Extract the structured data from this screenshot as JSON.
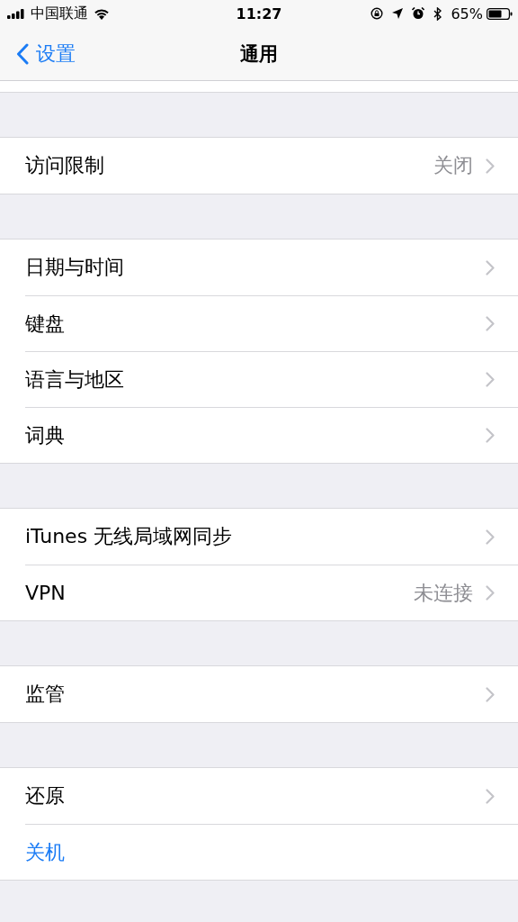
{
  "status_bar": {
    "carrier": "中国联通",
    "time": "11:27",
    "battery": "65%"
  },
  "nav": {
    "back": "设置",
    "title": "通用"
  },
  "groups": [
    {
      "rows": [
        {
          "kind": "link",
          "label": "访问限制",
          "value": "关闭"
        }
      ]
    },
    {
      "rows": [
        {
          "kind": "link",
          "label": "日期与时间"
        },
        {
          "kind": "link",
          "label": "键盘"
        },
        {
          "kind": "link",
          "label": "语言与地区"
        },
        {
          "kind": "link",
          "label": "词典"
        }
      ]
    },
    {
      "rows": [
        {
          "kind": "link",
          "label": "iTunes 无线局域网同步"
        },
        {
          "kind": "link",
          "label": "VPN",
          "value": "未连接"
        }
      ]
    },
    {
      "rows": [
        {
          "kind": "link",
          "label": "监管"
        }
      ]
    },
    {
      "rows": [
        {
          "kind": "link",
          "label": "还原"
        },
        {
          "kind": "action",
          "label": "关机"
        }
      ]
    }
  ]
}
